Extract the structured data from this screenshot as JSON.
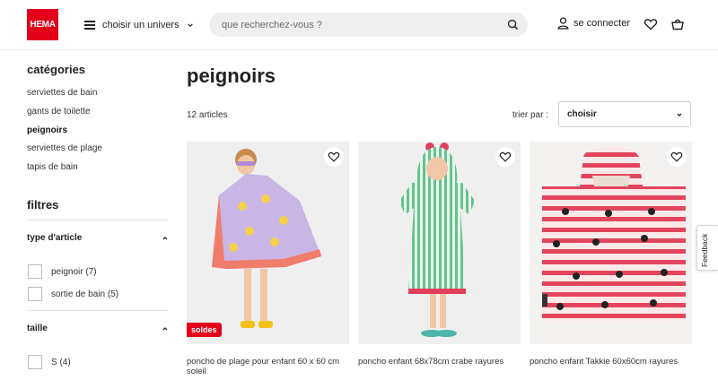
{
  "header": {
    "logo_text": "HEMA",
    "menu_label": "choisir un univers",
    "search_placeholder": "que recherchez-vous ?",
    "login_label": "se connecter",
    "icons": [
      "menu-icon",
      "chevron-down-icon",
      "search-icon",
      "user-icon",
      "heart-icon",
      "basket-icon"
    ],
    "brand_color": "#e3001b"
  },
  "sidebar": {
    "categories_title": "catégories",
    "categories": [
      {
        "label": "serviettes de bain",
        "active": false
      },
      {
        "label": "gants de toilette",
        "active": false
      },
      {
        "label": "peignoirs",
        "active": true
      },
      {
        "label": "serviettes de plage",
        "active": false
      },
      {
        "label": "tapis de bain",
        "active": false
      }
    ],
    "filters_title": "filtres",
    "filter_groups": [
      {
        "label": "type d'article",
        "expanded": true,
        "options": [
          {
            "label": "peignoir (7)",
            "checked": false
          },
          {
            "label": "sortie de bain (5)",
            "checked": false
          }
        ]
      },
      {
        "label": "taille",
        "expanded": true,
        "options": [
          {
            "label": "S (4)",
            "checked": false
          }
        ]
      }
    ]
  },
  "main": {
    "title": "peignoirs",
    "count": "12 articles",
    "sort_label": "trier par :",
    "sort_value": "choisir",
    "products": [
      {
        "name": "poncho de plage pour enfant 60 x 60 cm soleil",
        "badge": "soldes"
      },
      {
        "name": "poncho enfant 68x78cm crabe rayures",
        "badge": ""
      },
      {
        "name": "poncho enfant Takkie 60x60cm rayures",
        "badge": ""
      }
    ]
  },
  "feedback_label": "Feedback"
}
